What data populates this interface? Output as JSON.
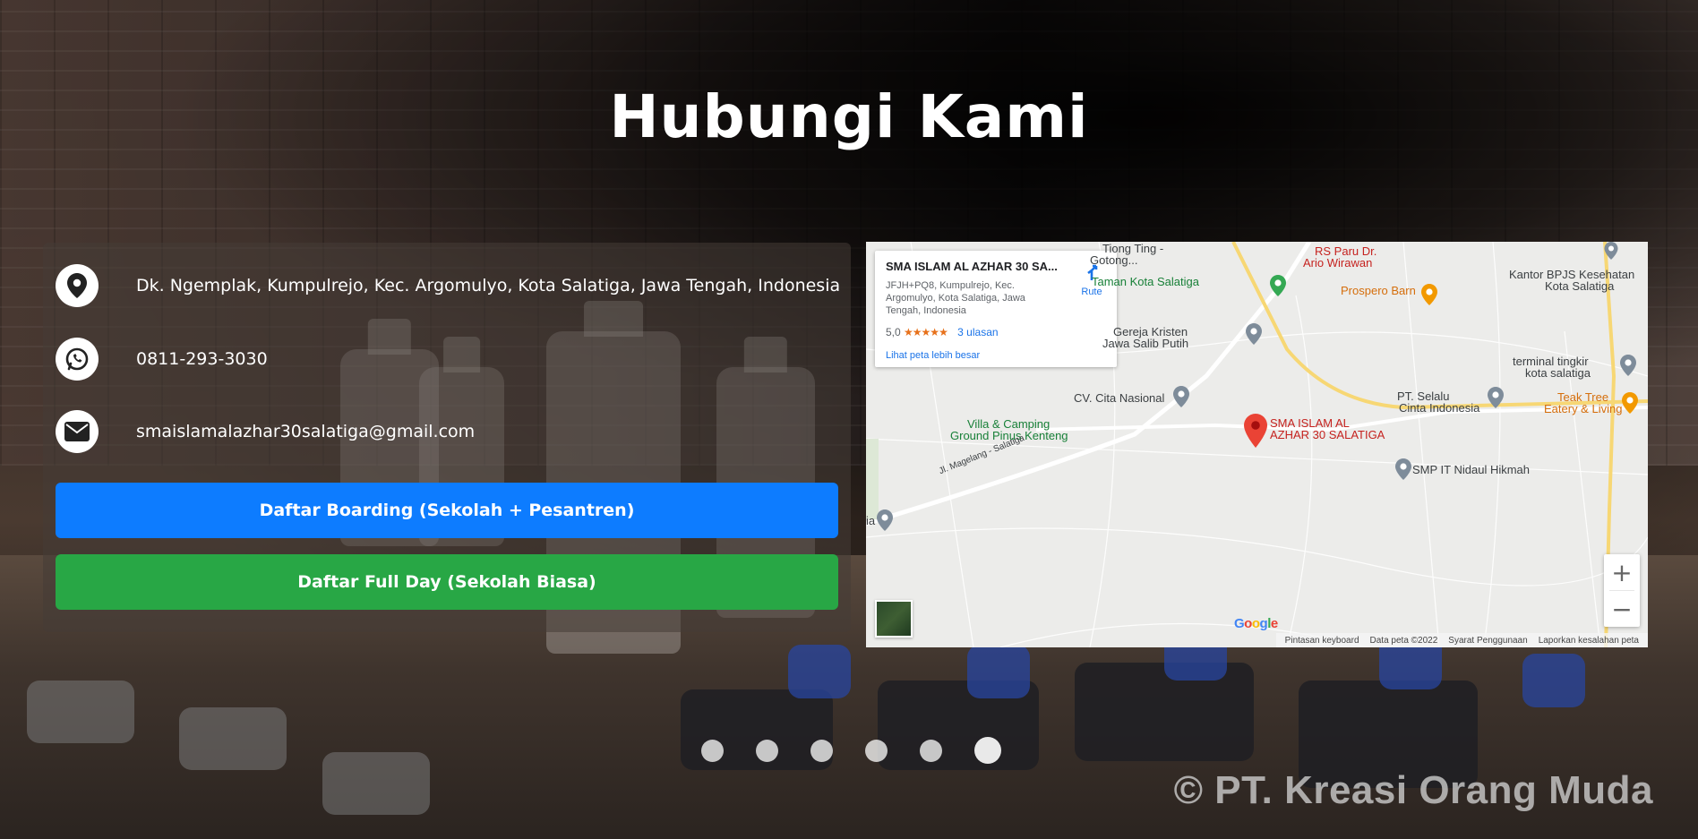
{
  "page": {
    "title": "Hubungi Kami",
    "watermark": "© PT. Kreasi Orang Muda"
  },
  "contact": {
    "address": "Dk. Ngemplak, Kumpulrejo, Kec. Argomulyo, Kota Salatiga, Jawa Tengah, Indonesia",
    "phone": "0811-293-3030",
    "email": "smaislamalazhar30salatiga@gmail.com",
    "icons": [
      "location-pin-icon",
      "whatsapp-icon",
      "envelope-icon"
    ]
  },
  "buttons": {
    "boarding_label": "Daftar Boarding (Sekolah + Pesantren)",
    "fullday_label": "Daftar Full Day (Sekolah Biasa)",
    "boarding_color": "#0d7cff",
    "fullday_color": "#28a745"
  },
  "map": {
    "card_title": "SMA ISLAM AL AZHAR 30 SA...",
    "card_address": "JFJH+PQ8, Kumpulrejo, Kec. Argomulyo, Kota Salatiga, Jawa Tengah, Indonesia",
    "rating": "5,0",
    "stars": "★★★★★",
    "reviews": "3 ulasan",
    "route_label": "Rute",
    "larger_map_link": "Lihat peta lebih besar",
    "labels": {
      "tiong_ting": "Tiong Ting -",
      "gotong": "Gotong...",
      "rs_paru_1": "RS Paru Dr.",
      "rs_paru_2": "Ario Wirawan",
      "taman": "Taman Kota Salatiga",
      "prospero": "Prospero Barn",
      "kantor_1": "Kantor BPJS Kesehatan",
      "kantor_2": "Kota Salatiga",
      "gereja_1": "Gereja Kristen",
      "gereja_2": "Jawa Salib Putih",
      "terminal_1": "terminal tingkir",
      "terminal_2": "kota salatiga",
      "cv": "CV. Cita Nasional",
      "pt_selalu_1": "PT. Selalu",
      "pt_selalu_2": "Cinta Indonesia",
      "teak_1": "Teak Tree",
      "teak_2": "Eatery & Living",
      "villa_1": "Villa & Camping",
      "villa_2": "Ground Pinus Kenteng",
      "school_1": "SMA ISLAM AL",
      "school_2": "AZHAR 30 SALATIGA",
      "smp": "SMP IT Nidaul Hikmah",
      "road": "Jl. Magelang - Salatiga",
      "edge_left": "ia"
    },
    "zoom_in": "+",
    "zoom_out": "−",
    "google": "Google",
    "footer": {
      "keyboard": "Pintasan keyboard",
      "map_data": "Data peta ©2022",
      "terms": "Syarat Penggunaan",
      "report": "Laporkan kesalahan peta"
    }
  },
  "carousel": {
    "slide_count": 6,
    "active_index": 5
  }
}
